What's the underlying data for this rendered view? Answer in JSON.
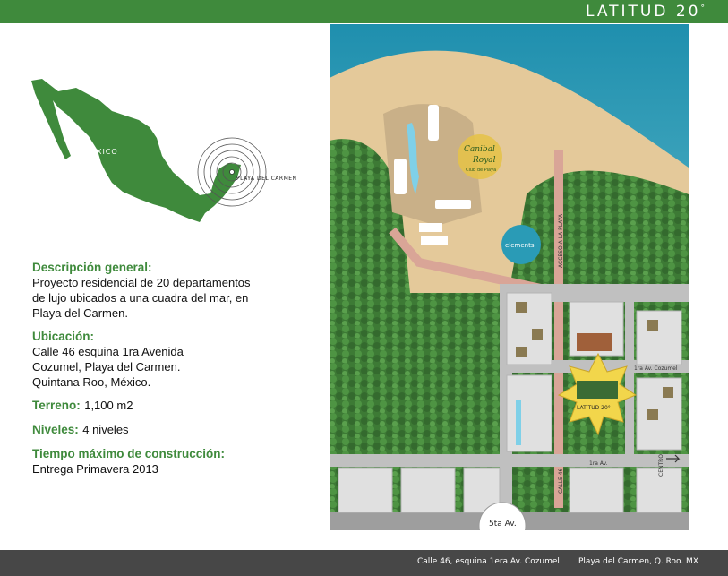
{
  "brand": {
    "name": "LATITUD 20",
    "degree": "°"
  },
  "map_labels": {
    "country": "MÉXICO",
    "city": "PLAYA DEL CARMEN"
  },
  "info": {
    "descripcion_title": "Descripción general:",
    "descripcion_text": "Proyecto residencial de 20 departamentos de lujo ubicados a una cuadra del mar, en Playa del Carmen.",
    "ubicacion_title": "Ubicación:",
    "ubicacion_lines": [
      "Calle 46 esquina 1ra Avenida",
      "Cozumel, Playa del Carmen.",
      "Quintana Roo, México."
    ],
    "terreno_title": "Terreno:",
    "terreno_value": "1,100 m2",
    "niveles_title": "Niveles:",
    "niveles_value": "4 niveles",
    "tiempo_title": "Tiempo máximo de construcción:",
    "tiempo_value": "Entrega Primavera 2013"
  },
  "site_map": {
    "resort_logo_line1": "Canibal",
    "resort_logo_line2": "Royal",
    "resort_logo_line3": "Club de Playa",
    "elements_logo": "elements",
    "acceso_label": "ACCESO A LA PLAYA",
    "cozumel_label": "1ra Av. Cozumel",
    "first_av_label": "1ra Av.",
    "calle46_label": "CALLE 46",
    "centro_label": "CENTRO",
    "fifth_av_label": "5ta Av.",
    "project_logo": "LATITUD 20°"
  },
  "footer": {
    "address1": "Calle 46, esquina 1era Av. Cozumel",
    "address2": "Playa del Carmen, Q. Roo. MX"
  },
  "colors": {
    "brand_green": "#3f8a3c",
    "footer_gray": "#474747",
    "sea": "#2aa6c0",
    "sand": "#e4c99a"
  }
}
